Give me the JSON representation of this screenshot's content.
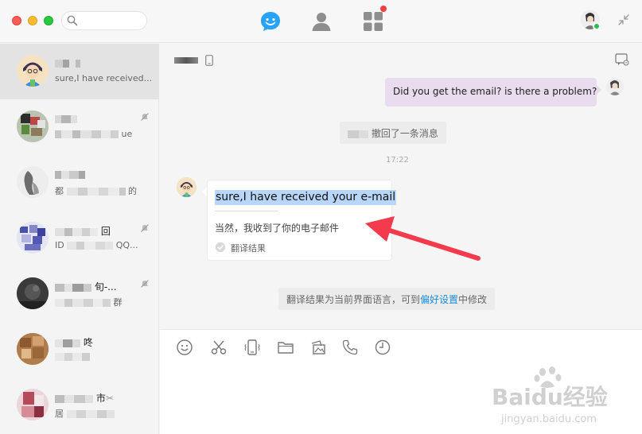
{
  "search": {
    "placeholder": ""
  },
  "sidebar": {
    "conversations": [
      {
        "preview": "sure,I have received..."
      },
      {
        "preview_tail": "ue"
      },
      {
        "preview_head": "都",
        "preview_tail": "的"
      },
      {
        "name_tail": "回",
        "preview_head": "ID",
        "preview_tail": "QQ..."
      },
      {
        "name_tail": "旬-...",
        "preview_tail": "群"
      },
      {
        "name_tail": "咚"
      },
      {
        "name_tail": "市",
        "preview_head": "居"
      }
    ]
  },
  "chat": {
    "outgoing_message": "Did you get the email? is there a problem?",
    "recall_notice": "撤回了一条消息",
    "time": "17:22",
    "incoming": {
      "original": "sure,I have received your e-mail",
      "translation": "当然，我收到了你的电子邮件",
      "translation_label": "翻译结果"
    },
    "setting_notice": {
      "before": "翻译结果为当前界面语言，可到",
      "link": "偏好设置",
      "after": "中修改"
    }
  },
  "input": {
    "value": ""
  },
  "watermark": {
    "brand": "Baidu经验",
    "url": "jingyan.baidu.com"
  },
  "colors": {
    "accent": "#27a3ff",
    "outgoing_bubble": "#e9dcef",
    "highlight": "#b7d6fa",
    "link": "#1a8ce0",
    "arrow": "#f43b4d"
  }
}
